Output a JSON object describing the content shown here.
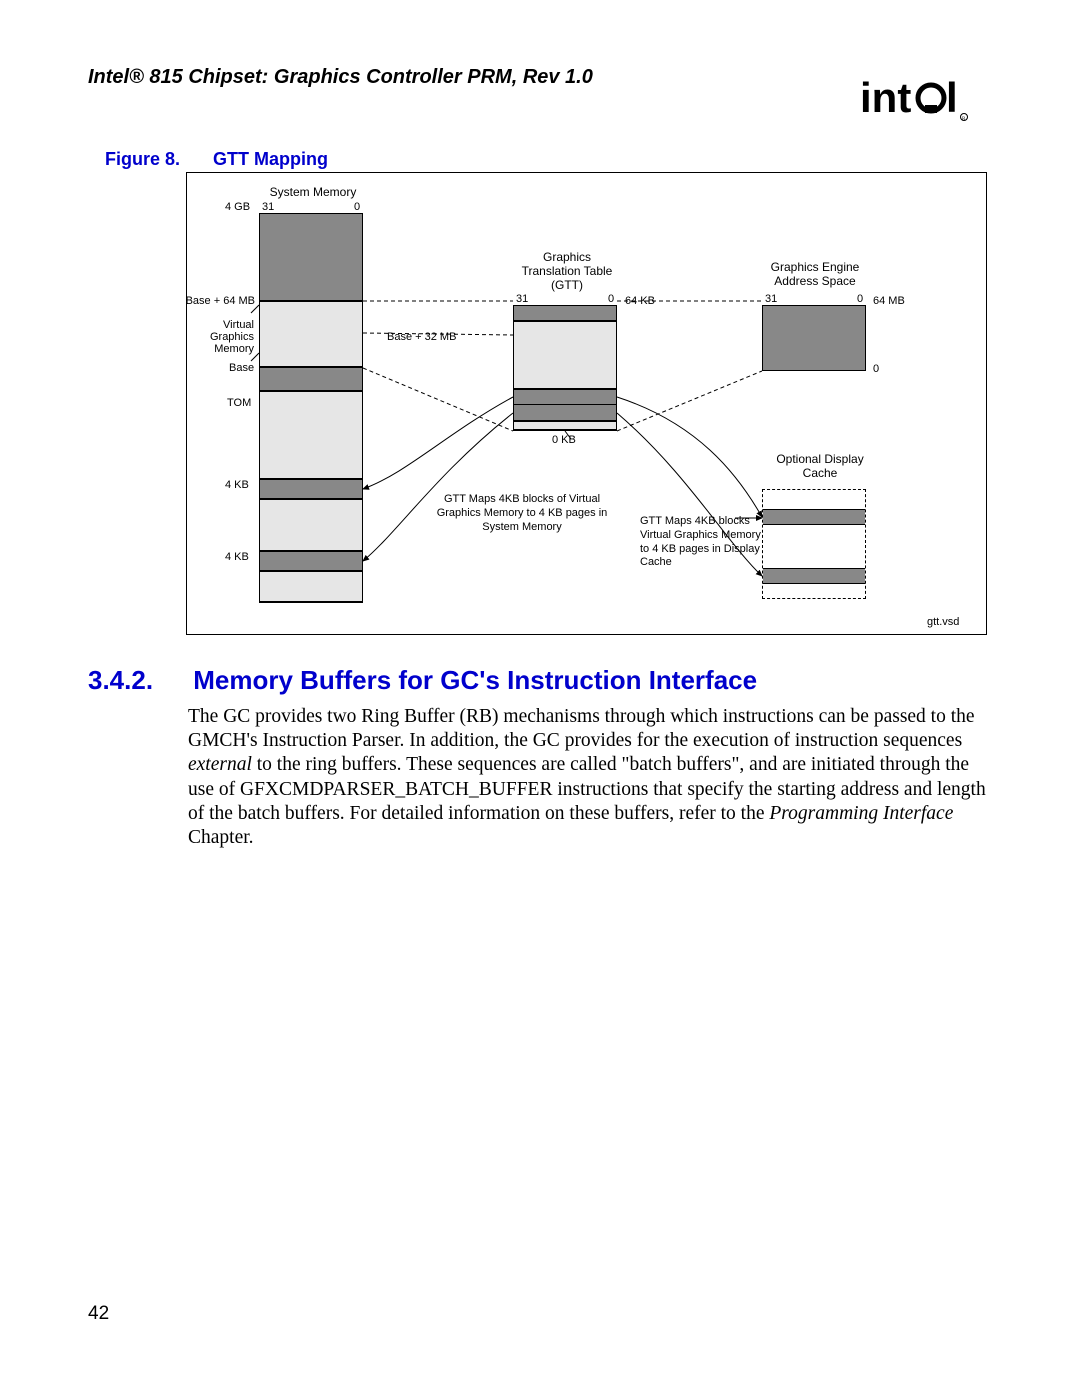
{
  "header": {
    "title": "Intel® 815 Chipset: Graphics Controller PRM, Rev 1.0"
  },
  "logo": {
    "name": "intel"
  },
  "figure": {
    "label": "Figure 8.",
    "title": "GTT Mapping",
    "labels": {
      "system_memory": "System Memory",
      "four_gb": "4 GB",
      "thirtyone_a": "31",
      "zero_a": "0",
      "base_plus_64": "Base + 64 MB",
      "virtual_graphics_memory": "Virtual\nGraphics\nMemory",
      "base": "Base",
      "tom": "TOM",
      "four_kb_a": "4 KB",
      "four_kb_b": "4 KB",
      "gtt_title": "Graphics\nTranslation Table\n(GTT)",
      "thirtyone_b": "31",
      "zero_b": "0",
      "sixtyfour_kb": "64 KB",
      "base_plus_32": "Base + 32 MB",
      "zero_kb": "0 KB",
      "eng_title": "Graphics Engine\nAddress Space",
      "thirtyone_c": "31",
      "zero_c": "0",
      "sixtyfour_mb": "64 MB",
      "zero_d": "0",
      "opt_cache": "Optional Display\nCache",
      "gtt_maps_sys": "GTT Maps 4KB blocks of Virtual\nGraphics Memory to 4 KB pages in\nSystem Memory",
      "gtt_maps_cache": "GTT Maps 4KB blocks\nVirtual Graphics Memory\nto 4 KB pages in Display\nCache",
      "filename": "gtt.vsd"
    }
  },
  "section": {
    "number": "3.4.2.",
    "title": "Memory Buffers for GC's Instruction Interface",
    "para_1a": "The GC provides two Ring Buffer (RB) mechanisms through which instructions can be passed to the GMCH's Instruction Parser. In addition, the GC provides for the execution of instruction sequences ",
    "para_1b_italic": "external",
    "para_1c": " to the ring buffers. These sequences are called \"batch buffers\", and are initiated through the use of GFXCMDPARSER_BATCH_BUFFER instructions that specify the starting address and length of the batch buffers. For detailed information on these buffers, refer to the ",
    "para_1d_italic": "Programming Interface",
    "para_1e": " Chapter."
  },
  "page_number": "42"
}
